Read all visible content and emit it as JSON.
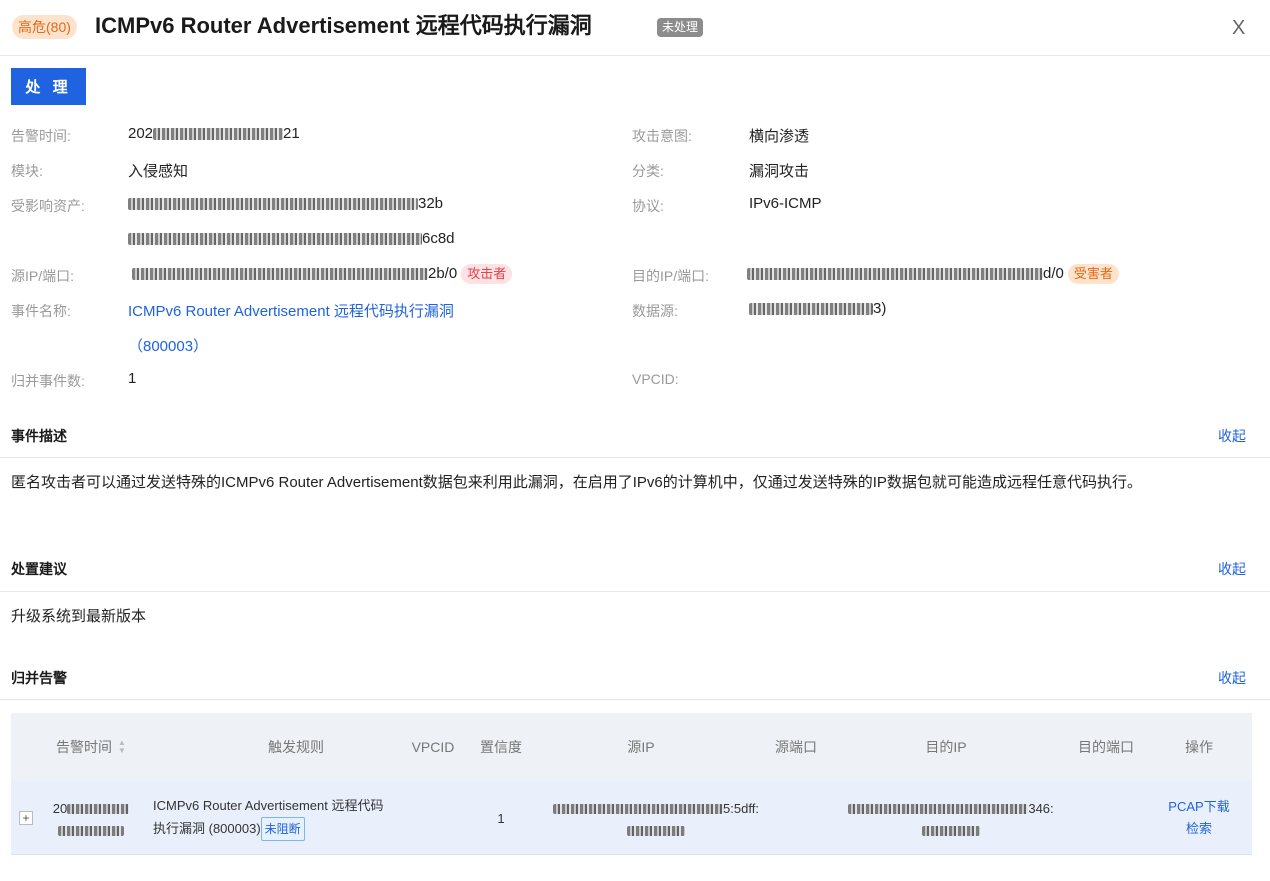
{
  "header": {
    "risk_label": "高危(80)",
    "title": "ICMPv6 Router Advertisement 远程代码执行漏洞",
    "status": "未处理",
    "close": "X"
  },
  "process_button": "处 理",
  "fields": {
    "alert_time_label": "告警时间:",
    "alert_time_visible_prefix": "202",
    "alert_time_visible_suffix": "21",
    "module_label": "模块:",
    "module_value": "入侵感知",
    "asset_label": "受影响资产:",
    "asset_1_suffix": "32b",
    "asset_2_suffix": "6c8d",
    "src_label": "源IP/端口:",
    "src_suffix": "2b/0",
    "src_tag": "攻击者",
    "event_name_label": "事件名称:",
    "event_name_value": "ICMPv6 Router Advertisement 远程代码执行漏洞",
    "event_name_id": "（800003）",
    "merged_count_label": "归并事件数:",
    "merged_count_value": "1",
    "intent_label": "攻击意图:",
    "intent_value": "横向渗透",
    "category_label": "分类:",
    "category_value": "漏洞攻击",
    "protocol_label": "协议:",
    "protocol_value": "IPv6-ICMP",
    "dst_label": "目的IP/端口:",
    "dst_suffix": "d/0",
    "dst_tag": "受害者",
    "datasource_label": "数据源:",
    "datasource_suffix": "3)",
    "vpcid_label": "VPCID:"
  },
  "sections": {
    "description": {
      "title": "事件描述",
      "collapse": "收起",
      "text": "匿名攻击者可以通过发送特殊的ICMPv6 Router Advertisement数据包来利用此漏洞，在启用了IPv6的计算机中，仅通过发送特殊的IP数据包就可能造成远程任意代码执行。"
    },
    "suggestion": {
      "title": "处置建议",
      "collapse": "收起",
      "text": "升级系统到最新版本"
    },
    "merged": {
      "title": "归并告警",
      "collapse": "收起"
    }
  },
  "table": {
    "headers": [
      "告警时间",
      "触发规则",
      "VPCID",
      "置信度",
      "源IP",
      "源端口",
      "目的IP",
      "目的端口",
      "操作"
    ],
    "row": {
      "expand": "+",
      "time_prefix": "20",
      "rule_text": "ICMPv6 Router Advertisement 远程代码执行漏洞 (800003)",
      "rule_tag": "未阻断",
      "confidence": "1",
      "src_ip_suffix": "5:5dff:",
      "dst_ip_suffix": "346:",
      "action_pcap": "PCAP下载",
      "action_search": "检索"
    }
  }
}
